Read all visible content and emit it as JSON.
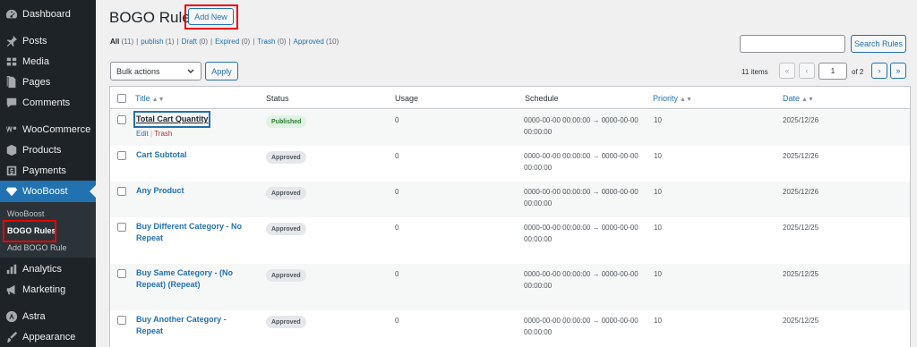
{
  "sidebar": {
    "items": [
      {
        "label": "Dashboard",
        "icon": "dashboard-icon"
      },
      {
        "label": "Posts",
        "icon": "pin-icon"
      },
      {
        "label": "Media",
        "icon": "media-icon"
      },
      {
        "label": "Pages",
        "icon": "pages-icon"
      },
      {
        "label": "Comments",
        "icon": "comment-icon"
      },
      {
        "label": "WooCommerce",
        "icon": "woocommerce-icon"
      },
      {
        "label": "Products",
        "icon": "products-icon"
      },
      {
        "label": "Payments",
        "icon": "payments-icon"
      },
      {
        "label": "WooBoost",
        "icon": "wooboost-icon",
        "active": true
      },
      {
        "label": "Analytics",
        "icon": "analytics-icon"
      },
      {
        "label": "Marketing",
        "icon": "marketing-icon"
      },
      {
        "label": "Astra",
        "icon": "astra-icon"
      },
      {
        "label": "Appearance",
        "icon": "appearance-icon"
      }
    ],
    "submenu": [
      "WooBoost",
      "BOGO Rules",
      "Add BOGO Rule"
    ]
  },
  "page": {
    "title": "BOGO Rules",
    "add_new": "Add New",
    "search_button": "Search Rules",
    "bulk_actions": "Bulk actions",
    "apply": "Apply",
    "items_count": "11 items",
    "current_page": "1",
    "of_pages": "of 2",
    "first": "«",
    "prev": "‹",
    "next": "›",
    "last": "»"
  },
  "filters": [
    {
      "label": "All",
      "count": "(11)",
      "current": true
    },
    {
      "label": "publish",
      "count": "(1)"
    },
    {
      "label": "Draft",
      "count": "(0)"
    },
    {
      "label": "Expired",
      "count": "(0)"
    },
    {
      "label": "Trash",
      "count": "(0)"
    },
    {
      "label": "Approved",
      "count": "(10)"
    }
  ],
  "table": {
    "columns": {
      "title": "Title",
      "status": "Status",
      "usage": "Usage",
      "schedule": "Schedule",
      "priority": "Priority",
      "date": "Date"
    },
    "row_actions": {
      "edit": "Edit",
      "trash": "Trash"
    },
    "rows": [
      {
        "title": "Total Cart Quantity",
        "status": "Published",
        "usage": "0",
        "schedule": "0000-00-00 00:00:00 → 0000-00-00 00:00:00",
        "priority": "10",
        "date": "2025/12/26"
      },
      {
        "title": "Cart Subtotal",
        "status": "Approved",
        "usage": "0",
        "schedule": "0000-00-00 00:00:00 → 0000-00-00 00:00:00",
        "priority": "10",
        "date": "2025/12/26"
      },
      {
        "title": "Any Product",
        "status": "Approved",
        "usage": "0",
        "schedule": "0000-00-00 00:00:00 → 0000-00-00 00:00:00",
        "priority": "10",
        "date": "2025/12/26"
      },
      {
        "title": "Buy Different Category - No Repeat",
        "status": "Approved",
        "usage": "0",
        "schedule": "0000-00-00 00:00:00 → 0000-00-00 00:00:00",
        "priority": "10",
        "date": "2025/12/25"
      },
      {
        "title": "Buy Same Category - (No Repeat) (Repeat)",
        "status": "Approved",
        "usage": "0",
        "schedule": "0000-00-00 00:00:00 → 0000-00-00 00:00:00",
        "priority": "10",
        "date": "2025/12/25"
      },
      {
        "title": "Buy Another Category - Repeat",
        "status": "Approved",
        "usage": "0",
        "schedule": "0000-00-00 00:00:00 → 0000-00-00 00:00:00",
        "priority": "10",
        "date": "2025/12/25"
      }
    ]
  }
}
